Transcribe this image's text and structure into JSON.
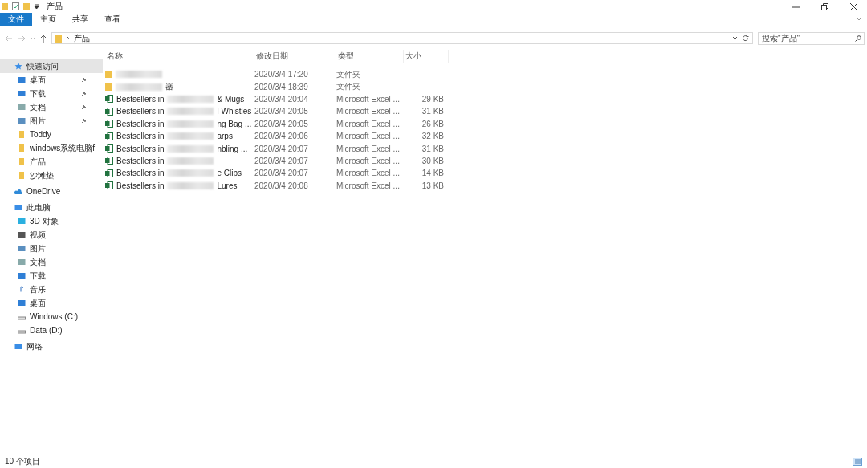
{
  "window": {
    "title": "产品"
  },
  "ribbon_tabs": [
    {
      "label": "文件",
      "selected": true
    },
    {
      "label": "主页",
      "selected": false
    },
    {
      "label": "共享",
      "selected": false
    },
    {
      "label": "查看",
      "selected": false
    }
  ],
  "address": {
    "path": "产品"
  },
  "search": {
    "placeholder": "搜索\"产品\""
  },
  "sidebar": {
    "items": [
      {
        "label": "快速访问",
        "kind": "quick",
        "selected": true,
        "pinned": false,
        "children": [
          {
            "label": "桌面",
            "kind": "desktop",
            "selected": false,
            "pinned": true
          },
          {
            "label": "下载",
            "kind": "download",
            "selected": false,
            "pinned": true
          },
          {
            "label": "文档",
            "kind": "document",
            "selected": false,
            "pinned": true
          },
          {
            "label": "图片",
            "kind": "picture",
            "selected": false,
            "pinned": true
          },
          {
            "label": "Toddy",
            "kind": "folder",
            "selected": false,
            "pinned": false
          },
          {
            "label": "windows系统电脑f",
            "kind": "folder",
            "selected": false,
            "pinned": false
          },
          {
            "label": "产品",
            "kind": "folder",
            "selected": false,
            "pinned": false
          },
          {
            "label": "沙滩垫",
            "kind": "folder",
            "selected": false,
            "pinned": false
          }
        ]
      },
      {
        "label": "OneDrive",
        "kind": "cloud",
        "selected": false,
        "pinned": false
      },
      {
        "label": "此电脑",
        "kind": "pc",
        "selected": false,
        "pinned": false,
        "children": [
          {
            "label": "3D 对象",
            "kind": "cube",
            "selected": false,
            "pinned": false
          },
          {
            "label": "视频",
            "kind": "video",
            "selected": false,
            "pinned": false
          },
          {
            "label": "图片",
            "kind": "picture",
            "selected": false,
            "pinned": false
          },
          {
            "label": "文档",
            "kind": "document",
            "selected": false,
            "pinned": false
          },
          {
            "label": "下载",
            "kind": "download",
            "selected": false,
            "pinned": false
          },
          {
            "label": "音乐",
            "kind": "music",
            "selected": false,
            "pinned": false
          },
          {
            "label": "桌面",
            "kind": "desktop",
            "selected": false,
            "pinned": false
          },
          {
            "label": "Windows (C:)",
            "kind": "drive",
            "selected": false,
            "pinned": false
          },
          {
            "label": "Data (D:)",
            "kind": "drive",
            "selected": false,
            "pinned": false
          }
        ]
      },
      {
        "label": "网络",
        "kind": "network",
        "selected": false,
        "pinned": false
      }
    ]
  },
  "columns": [
    "名称",
    "修改日期",
    "类型",
    "大小"
  ],
  "files": [
    {
      "kind": "folder",
      "modified": "2020/3/4 17:20",
      "type": "文件夹"
    },
    {
      "kind": "folder",
      "name_end": "器",
      "modified": "2020/3/4 18:39",
      "type": "文件夹"
    },
    {
      "kind": "excel",
      "name_start": "Bestsellers in",
      "name_end": "& Mugs",
      "modified": "2020/3/4 20:04",
      "type": "Microsoft Excel ...",
      "size": "29 KB"
    },
    {
      "kind": "excel",
      "name_start": "Bestsellers in",
      "name_end": "l Whistles",
      "modified": "2020/3/4 20:05",
      "type": "Microsoft Excel ...",
      "size": "31 KB"
    },
    {
      "kind": "excel",
      "name_start": "Bestsellers in",
      "name_end": "ng Bag ...",
      "modified": "2020/3/4 20:05",
      "type": "Microsoft Excel ...",
      "size": "26 KB"
    },
    {
      "kind": "excel",
      "name_start": "Bestsellers in",
      "name_end": "arps",
      "modified": "2020/3/4 20:06",
      "type": "Microsoft Excel ...",
      "size": "32 KB"
    },
    {
      "kind": "excel",
      "name_start": "Bestsellers in",
      "name_end": "nbling ...",
      "modified": "2020/3/4 20:07",
      "type": "Microsoft Excel ...",
      "size": "31 KB"
    },
    {
      "kind": "excel",
      "name_start": "Bestsellers in",
      "modified": "2020/3/4 20:07",
      "type": "Microsoft Excel ...",
      "size": "30 KB"
    },
    {
      "kind": "excel",
      "name_start": "Bestsellers in",
      "name_end": "e Clips",
      "modified": "2020/3/4 20:07",
      "type": "Microsoft Excel ...",
      "size": "14 KB"
    },
    {
      "kind": "excel",
      "name_start": "Bestsellers in",
      "name_end": "Lures",
      "modified": "2020/3/4 20:08",
      "type": "Microsoft Excel ...",
      "size": "13 KB"
    }
  ],
  "status_bar": {
    "count": "10 个项目"
  }
}
